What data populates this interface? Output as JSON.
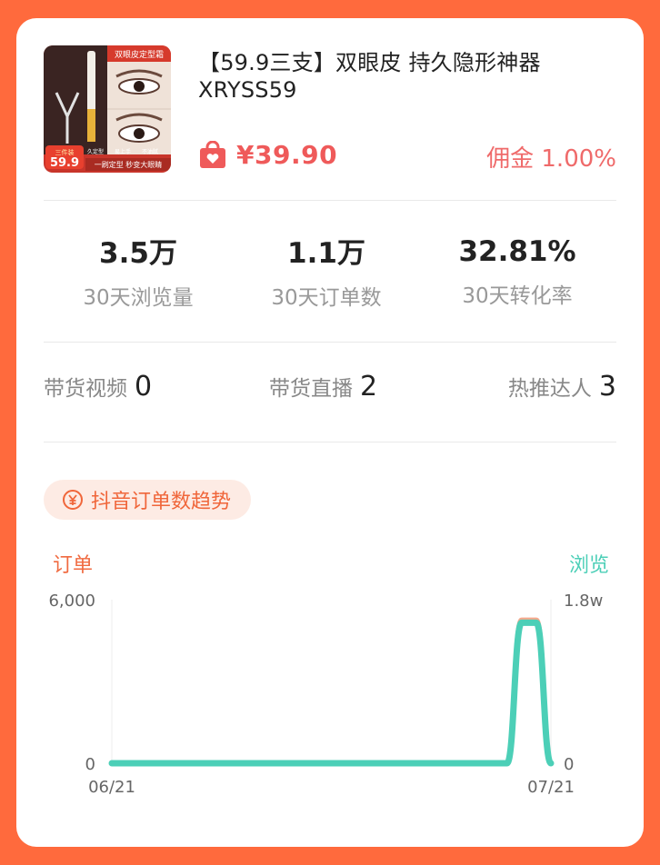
{
  "product": {
    "title": "【59.9三支】双眼皮 持久隐形神器 XRYSS59",
    "thumbnail_texts": {
      "brand_banner": "双眼皮定型霜",
      "promo_price": "59.9",
      "promo_tag": "三件装",
      "bottom_slogan": "一刷定型 秒变大眼睛",
      "features": [
        "久定型",
        "易上手",
        "不油腻"
      ]
    },
    "price": "¥39.90",
    "commission_label": "佣金",
    "commission_value": "1.00%"
  },
  "stats": [
    {
      "value": "3.5万",
      "label": "30天浏览量"
    },
    {
      "value": "1.1万",
      "label": "30天订单数"
    },
    {
      "value": "32.81%",
      "label": "30天转化率"
    }
  ],
  "counts": [
    {
      "label": "带货视频",
      "value": "0"
    },
    {
      "label": "带货直播",
      "value": "2"
    },
    {
      "label": "热推达人",
      "value": "3"
    }
  ],
  "trend": {
    "title": "抖音订单数趋势"
  },
  "chart_data": {
    "type": "line",
    "x_start": "06/21",
    "x_end": "07/21",
    "left_axis_title": "订单",
    "right_axis_title": "浏览",
    "left_ticks": [
      "6,000",
      "0"
    ],
    "right_ticks": [
      "1.8w",
      "0"
    ],
    "ylim_left": [
      0,
      6000
    ],
    "ylim_right": [
      0,
      18000
    ],
    "x_labels": [
      "06/21",
      "07/21"
    ],
    "series": [
      {
        "name": "订单",
        "axis": "left",
        "color": "#f4a98d",
        "values": [
          0,
          0,
          0,
          0,
          0,
          0,
          0,
          0,
          0,
          0,
          0,
          0,
          0,
          0,
          0,
          0,
          0,
          0,
          0,
          0,
          0,
          0,
          0,
          0,
          0,
          0,
          0,
          0,
          5900,
          5900,
          0
        ]
      },
      {
        "name": "浏览",
        "axis": "right",
        "color": "#4ccfb7",
        "values": [
          0,
          0,
          0,
          0,
          0,
          0,
          0,
          0,
          0,
          0,
          0,
          0,
          0,
          0,
          0,
          0,
          0,
          0,
          0,
          0,
          0,
          0,
          0,
          0,
          0,
          0,
          0,
          0,
          17400,
          17400,
          0
        ]
      }
    ]
  },
  "colors": {
    "background": "#ff6a3d",
    "price": "#ef5a5a",
    "orders_axis": "#f06a40",
    "views_axis": "#4ccfb7"
  }
}
